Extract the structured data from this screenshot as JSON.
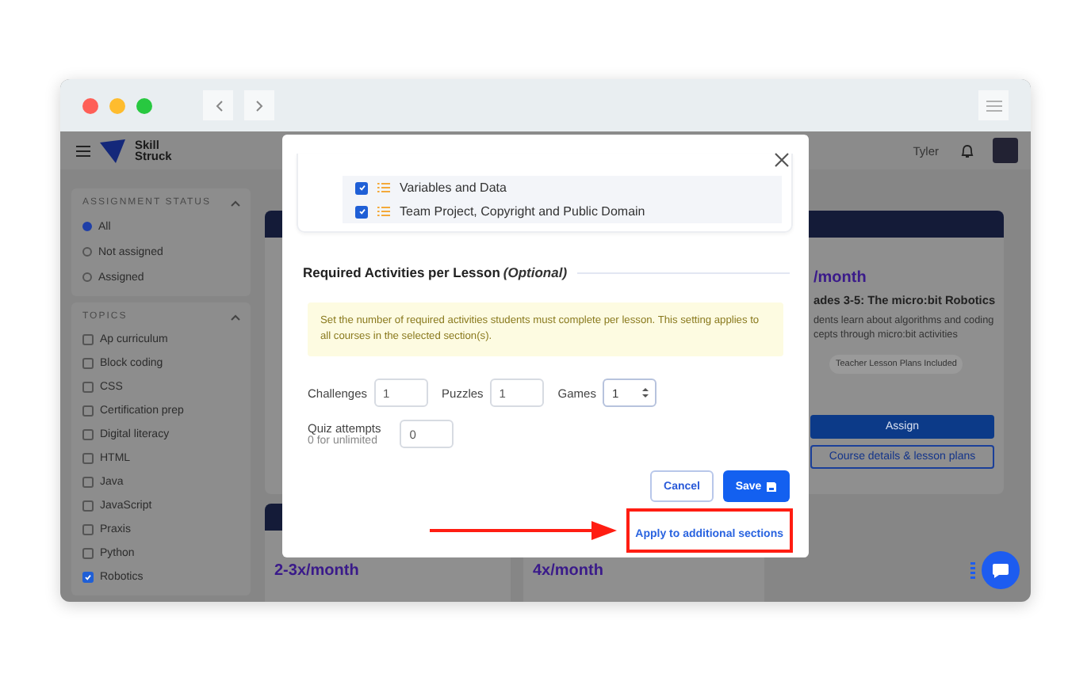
{
  "header": {
    "logo_text": "Skill Struck",
    "user_name": "Tyler"
  },
  "sidebar": {
    "sections": [
      {
        "title": "ASSIGNMENT STATUS",
        "kind": "radio",
        "expanded": true,
        "options": [
          {
            "label": "All",
            "selected": true
          },
          {
            "label": "Not assigned",
            "selected": false
          },
          {
            "label": "Assigned",
            "selected": false
          }
        ]
      },
      {
        "title": "TOPICS",
        "kind": "checkbox",
        "expanded": true,
        "options": [
          {
            "label": "Ap curriculum",
            "checked": false
          },
          {
            "label": "Block coding",
            "checked": false
          },
          {
            "label": "CSS",
            "checked": false
          },
          {
            "label": "Certification prep",
            "checked": false
          },
          {
            "label": "Digital literacy",
            "checked": false
          },
          {
            "label": "HTML",
            "checked": false
          },
          {
            "label": "Java",
            "checked": false
          },
          {
            "label": "JavaScript",
            "checked": false
          },
          {
            "label": "Praxis",
            "checked": false
          },
          {
            "label": "Python",
            "checked": false
          },
          {
            "label": "Robotics",
            "checked": true
          }
        ]
      }
    ]
  },
  "featured_card": {
    "frequency": "/month",
    "title": "ades 3-5: The micro:bit Robotics",
    "description": "dents learn about algorithms and coding cepts through micro:bit activities",
    "tag": "Teacher Lesson Plans Included",
    "assign": "Assign",
    "details": "Course details & lesson plans"
  },
  "bottom_cards": [
    {
      "frequency": "2-3x/month"
    },
    {
      "frequency": "4x/month"
    }
  ],
  "modal": {
    "lessons": [
      {
        "title": "Variables and Data",
        "checked": true
      },
      {
        "title": "Team Project, Copyright and Public Domain",
        "checked": true
      }
    ],
    "section_title": "Required Activities per Lesson",
    "section_note": "(Optional)",
    "notice": "Set the number of required activities students must complete per lesson. This setting applies to all courses in the selected section(s).",
    "fields": [
      {
        "label": "Challenges",
        "value": "1",
        "kind": "text"
      },
      {
        "label": "Puzzles",
        "value": "1",
        "kind": "text"
      },
      {
        "label": "Games",
        "value": "1",
        "kind": "spinner"
      }
    ],
    "quiz": {
      "label": "Quiz attempts",
      "hint": "0 for unlimited",
      "value": "0"
    },
    "cancel": "Cancel",
    "save": "Save",
    "link": "Apply to additional sections"
  }
}
